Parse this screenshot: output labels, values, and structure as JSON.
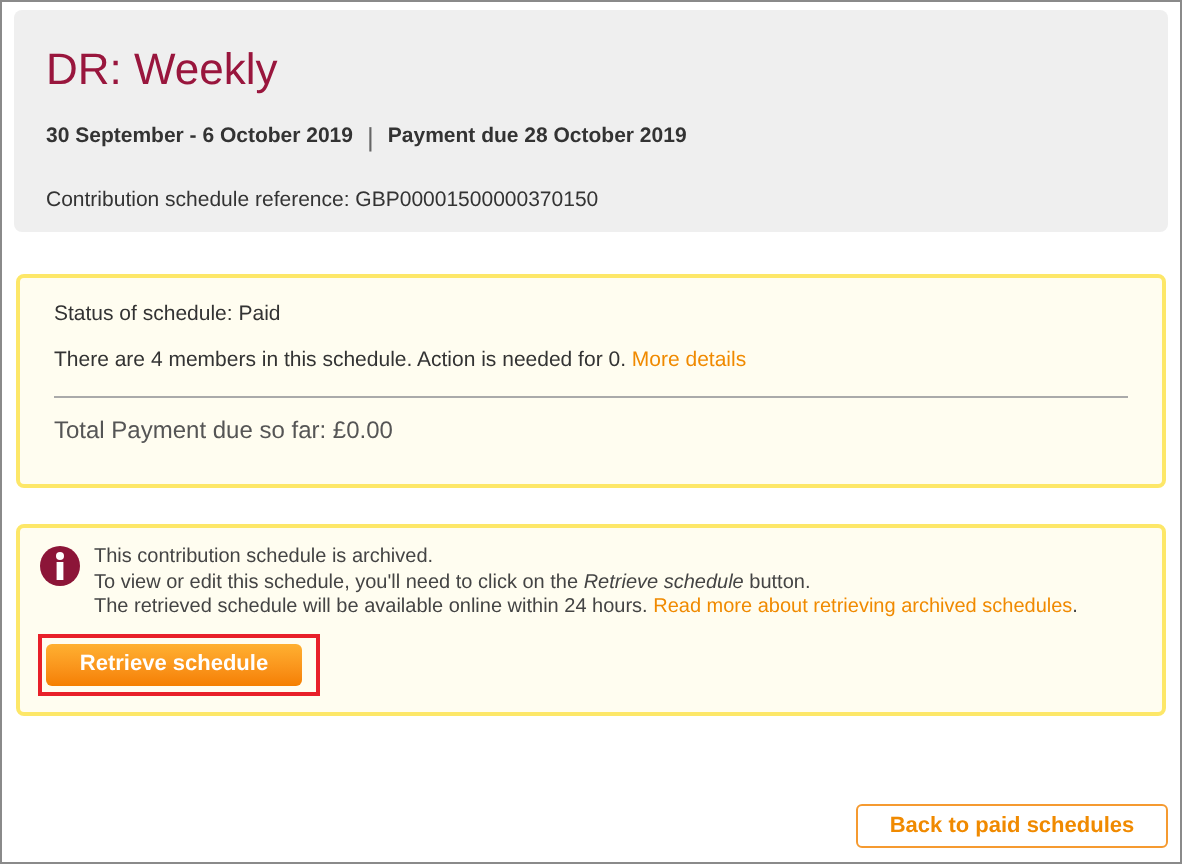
{
  "header": {
    "title": "DR: Weekly",
    "period": "30 September - 6 October 2019",
    "separator": "|",
    "payment_due": "Payment due 28 October 2019",
    "reference": "Contribution schedule reference: GBP00001500000370150"
  },
  "status": {
    "status_text": "Status of schedule: Paid",
    "members_text": "There are 4 members in this schedule. Action is needed for 0.",
    "members_link": "More details",
    "total": "Total Payment due so far: £0.00"
  },
  "archive_notice": {
    "lines": [
      "This contribution schedule is archived.",
      "To view or edit this schedule, you'll need to click on the *Retrieve schedule* button.",
      "The retrieved schedule will be available online within 24 hours."
    ],
    "link": "Read more about retrieving archived schedules",
    "link_suffix": ".",
    "button": {
      "label": "Retrieve schedule",
      "highlighted": true
    }
  },
  "back_button": "Back to paid schedules"
}
